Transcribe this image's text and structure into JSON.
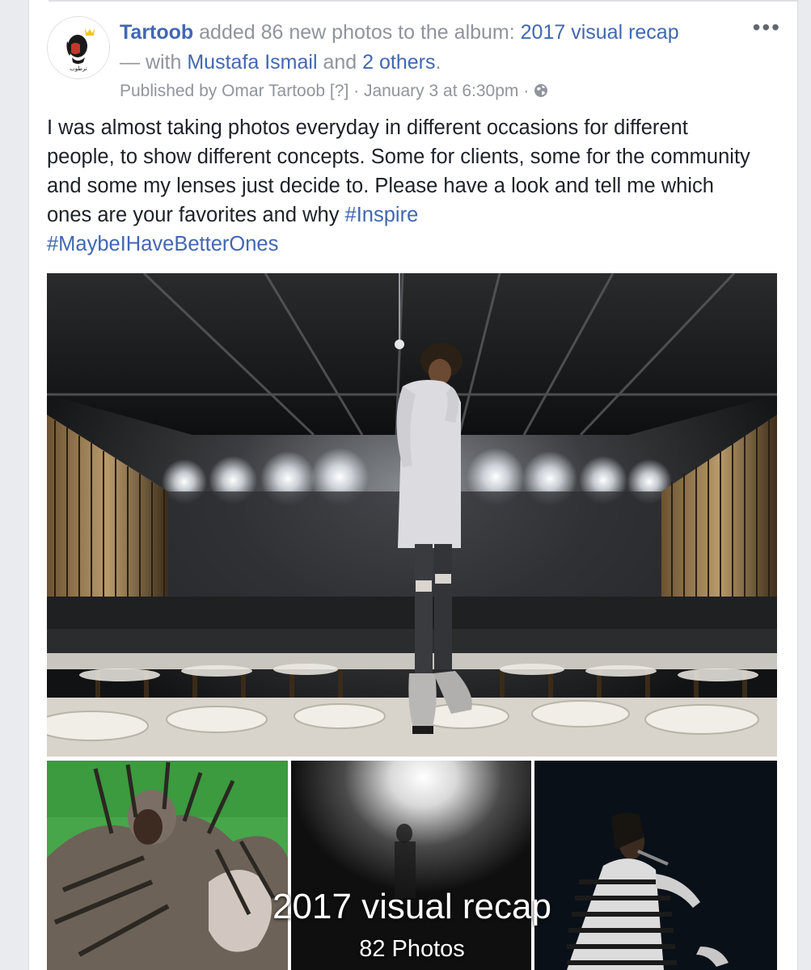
{
  "post": {
    "author": "Tartoob",
    "action_text": " added 86 new photos to the album: ",
    "album_link": "2017 visual recap",
    "with_prefix": "— with ",
    "tagged_person": "Mustafa Ismail",
    "and_text": " and ",
    "others_link": "2 others",
    "period": ".",
    "published_by": "Published by Omar Tartoob",
    "help_marker": " [?]",
    "separator": " · ",
    "timestamp": "January 3 at 6:30pm",
    "privacy_icon": "globe-icon",
    "more_label": "•••",
    "body_text": "I was almost taking photos everyday in different occasions for different people, to show different concepts. Some for clients, some for the community and some my lenses just decide to. Please have a look and tell me which ones are your favorites and why ",
    "hashtag_1": "#Inspire",
    "hashtag_2": "#MaybeIHaveBetterOnes"
  },
  "album_overlay": {
    "title": "2017 visual recap",
    "count_label": "82 Photos"
  },
  "colors": {
    "link": "#4267b2",
    "secondary_text": "#90949c",
    "body_text": "#1d2129",
    "page_background": "#e9ebee"
  }
}
